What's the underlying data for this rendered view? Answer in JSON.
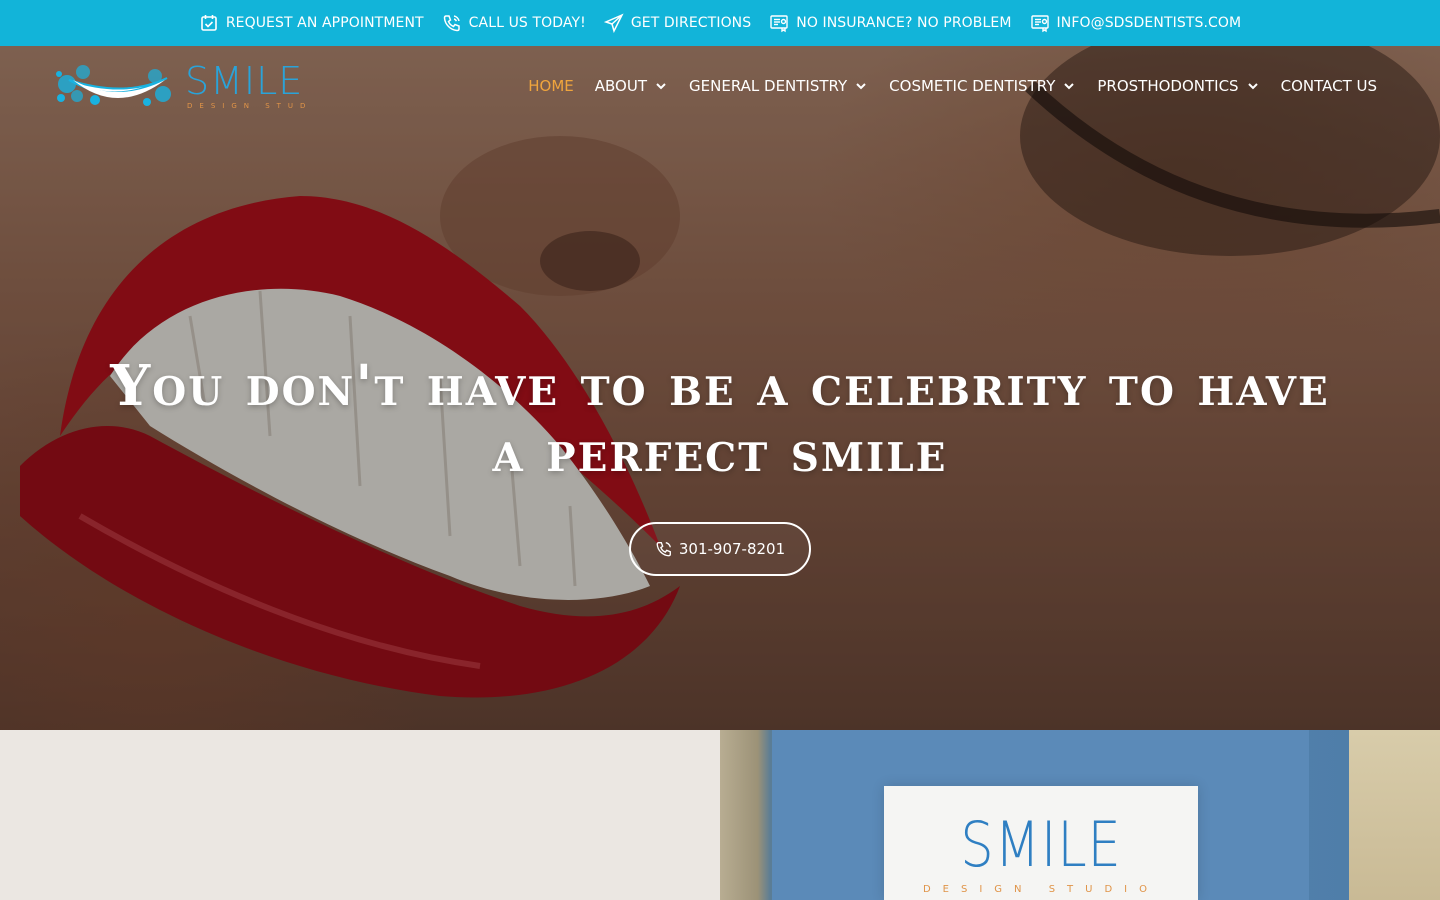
{
  "topbar": {
    "items": [
      {
        "label": "REQUEST AN APPOINTMENT",
        "icon": "calendar-check-icon"
      },
      {
        "label": "CALL US TODAY!",
        "icon": "phone-icon"
      },
      {
        "label": "GET DIRECTIONS",
        "icon": "paper-plane-icon"
      },
      {
        "label": "NO INSURANCE? NO PROBLEM",
        "icon": "document-icon"
      },
      {
        "label": "INFO@SDSDENTISTS.COM",
        "icon": "envelope-document-icon"
      }
    ],
    "background": "#12b4d9"
  },
  "logo": {
    "name": "SMILE",
    "tagline": "DESIGN STUDIO"
  },
  "nav": {
    "items": [
      {
        "label": "HOME",
        "active": true
      },
      {
        "label": "ABOUT",
        "has_dropdown": true
      },
      {
        "label": "GENERAL DENTISTRY",
        "has_dropdown": true
      },
      {
        "label": "COSMETIC DENTISTRY",
        "has_dropdown": true
      },
      {
        "label": "PROSTHODONTICS",
        "has_dropdown": true
      },
      {
        "label": "CONTACT US"
      }
    ],
    "active_color": "#f0a53d"
  },
  "hero": {
    "title_line1": "You don't have to be a celebrity to have",
    "title_line2": "a perfect smile",
    "cta_phone": "301-907-8201"
  },
  "office_sign": {
    "name": "SMILE",
    "tagline": "DESIGN STUDIO"
  }
}
